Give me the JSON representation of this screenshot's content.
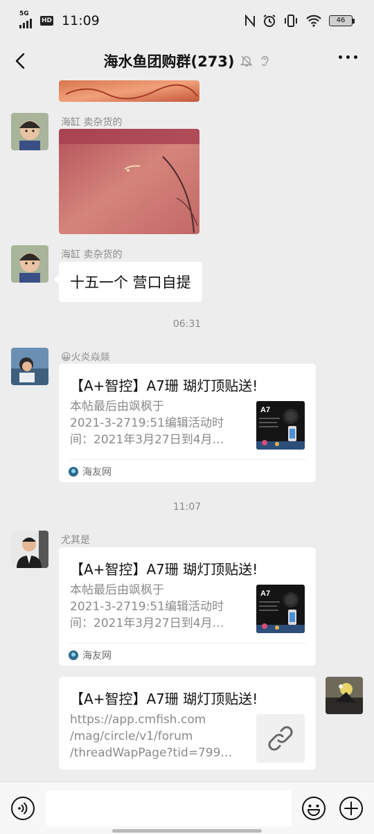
{
  "status_bar": {
    "network": "5G",
    "hd": "HD",
    "time": "11:09",
    "battery": "46"
  },
  "header": {
    "back_icon": "back-arrow-icon",
    "title": "海水鱼团购群(273)",
    "more_icon": "more-dots-icon"
  },
  "messages": {
    "m1_sender": "海缸 卖杂货的",
    "m2_sender": "海缸 卖杂货的",
    "m2_text": "十五一个 营口自提",
    "ts1": "06:31",
    "m3_sender": "😀火炎焱燚",
    "ts2": "11:07",
    "m4_sender": "尤其是"
  },
  "cards": [
    {
      "title": "【A+智控】A7珊 瑚灯顶贴送!",
      "desc": [
        "本帖最后由飒枫于",
        "2021-3-2719:51编辑活动时",
        "间：2021年3月27日到4月…"
      ],
      "thumb_label": "A7",
      "source": "海友网"
    },
    {
      "title": "【A+智控】A7珊 瑚灯顶贴送!",
      "desc": [
        "本帖最后由飒枫于",
        "2021-3-2719:51编辑活动时",
        "间：2021年3月27日到4月…"
      ],
      "thumb_label": "A7",
      "source": "海友网"
    },
    {
      "title": "【A+智控】A7珊 瑚灯顶贴送!",
      "desc": [
        "https://app.cmfish.com",
        "/mag/circle/v1/forum",
        "/threadWapPage?tid=799…"
      ],
      "thumb_icon": "link-icon"
    }
  ],
  "input_bar": {
    "voice_icon": "voice-icon",
    "emoji_icon": "emoji-icon",
    "plus_icon": "plus-icon",
    "value": ""
  }
}
